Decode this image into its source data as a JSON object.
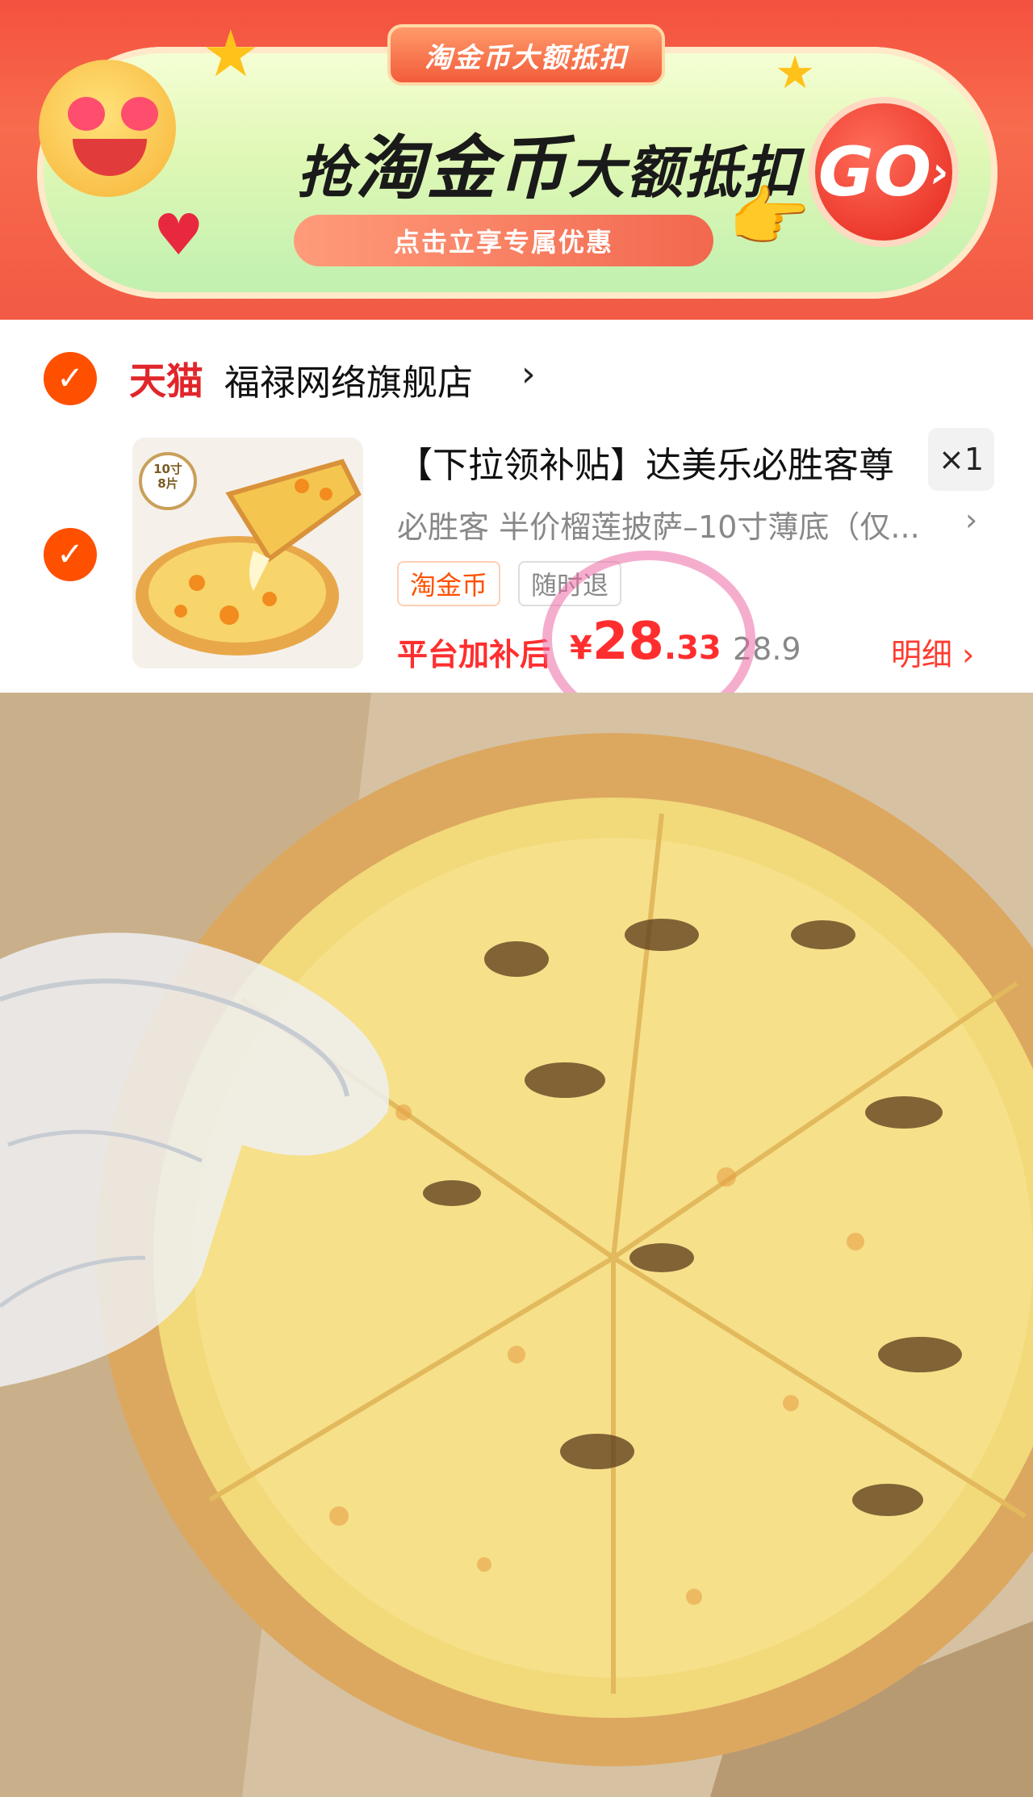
{
  "banner": {
    "tag": "淘金币大额抵扣",
    "headline_prefix": "抢",
    "headline_main": "淘金币",
    "headline_suffix": "大额抵扣",
    "subline": "点击立享专属优惠",
    "go_label": "GO",
    "go_arrow": "›"
  },
  "store": {
    "platform": "天猫",
    "name": "福禄网络旗舰店",
    "arrow": "›"
  },
  "item": {
    "thumb_badge_line1": "10寸",
    "thumb_badge_line2": "8片",
    "title": "【下拉领补贴】达美乐必胜客尊",
    "quantity": "×1",
    "spec": "必胜客 半价榴莲披萨–10寸薄底（仅...",
    "spec_arrow": "›",
    "tags": [
      "淘金币",
      "随时退"
    ],
    "price_label": "平台加补后",
    "price_currency": "¥",
    "price_int": "28",
    "price_dec": ".33",
    "original_price": "28.9",
    "detail_label": "明细 ›"
  },
  "colors": {
    "accent": "#ff5000",
    "price": "#ff2e2e",
    "tmall": "#e0262b"
  },
  "icons": {
    "check": "check-circle-icon",
    "chevron": "chevron-right-icon"
  }
}
